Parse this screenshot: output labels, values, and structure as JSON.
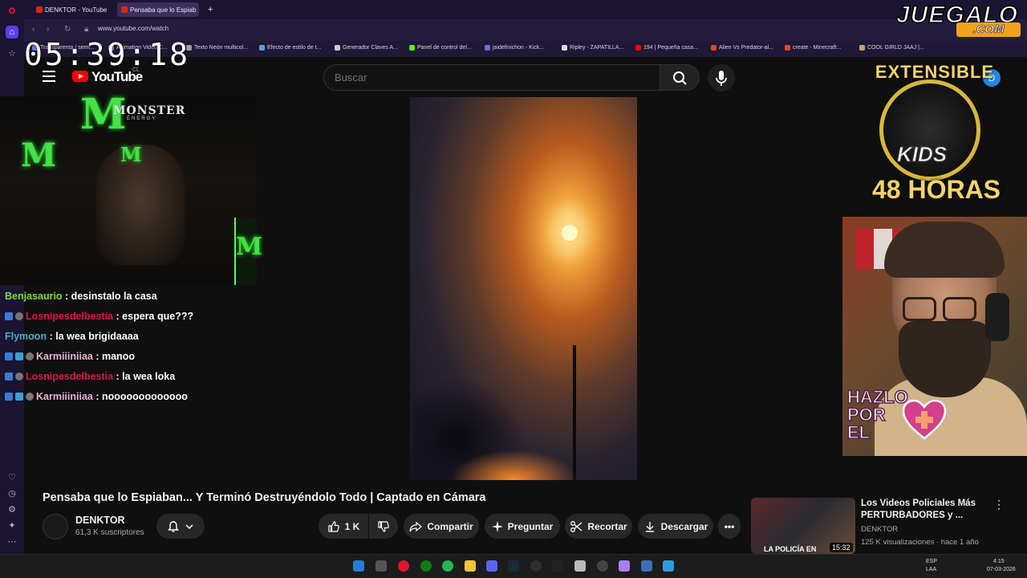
{
  "browser": {
    "tabs": [
      {
        "label": "DENKTOR - YouTube"
      },
      {
        "label": "Pensaba que lo Espiab"
      }
    ],
    "url": "www.youtube.com/watch",
    "bookmarks": [
      {
        "label": "Transparenta / semi..."
      },
      {
        "label": "Animation Video C..."
      },
      {
        "label": "Texto Neón multicol..."
      },
      {
        "label": "Efecto de estilo de t..."
      },
      {
        "label": "Generador Claves A..."
      },
      {
        "label": "Panel de control del..."
      },
      {
        "label": "jaidefinichon - Kick..."
      },
      {
        "label": "Ripley - ZAPATILLA..."
      },
      {
        "label": "194 | Pequeña casa..."
      },
      {
        "label": "Alien Vs Predator-al..."
      },
      {
        "label": "create - Minecraft..."
      },
      {
        "label": "COOL GIRLD JAAJ |..."
      }
    ]
  },
  "overlay": {
    "timer": "05:39:18",
    "brand_main": "JUEGALO",
    "brand_tld": ".COM",
    "monster_name": "MONSTER",
    "monster_sub": "ENERGY",
    "extensible": "EXTENSIBLE",
    "kids": "KIDS",
    "hours": "48 HORAS",
    "hazlo": "HAZLO\nPOR\nEL"
  },
  "youtube": {
    "logo_text": "YouTube",
    "country": "CL",
    "search_placeholder": "Buscar",
    "profile_initial": "D",
    "video_title": "Pensaba que lo Espiaban... Y Terminó Destruyéndolo Todo | Captado en Cámara",
    "channel_name": "DENKTOR",
    "subscribers": "61,3 K suscriptores",
    "likes": "1 K",
    "share_label": "Compartir",
    "ask_label": "Preguntar",
    "clip_label": "Recortar",
    "download_label": "Descargar",
    "recommendation": {
      "title": "Los Videos Policiales Más PERTURBADORES y ...",
      "channel": "DENKTOR",
      "meta": "125 K visualizaciones · hace 1 año",
      "duration": "15:32",
      "thumb_text": "LA POLICÍA EN"
    }
  },
  "chat": [
    {
      "user": "Benjasaurio",
      "message": ": desinstalo la casa",
      "color": "#7ddc3c"
    },
    {
      "user": "Losnipesdelbestia",
      "message": ": espera que???",
      "color": "#d81b4a"
    },
    {
      "user": "Flymoon",
      "message": ": la wea brigidaaaa",
      "color": "#3ab7c9"
    },
    {
      "user": "Karmiiiniiaa",
      "message": ": manoo",
      "color": "#e8b0d6"
    },
    {
      "user": "Losnipesdelbestia",
      "message": ": la wea loka",
      "color": "#d81b4a"
    },
    {
      "user": "Karmiiiniiaa",
      "message": ": nooooooooooooo",
      "color": "#e8b0d6"
    }
  ],
  "taskbar": {
    "lang1": "ESP",
    "lang2": "LAA",
    "time": "4:15",
    "date": "07-03-2026"
  }
}
